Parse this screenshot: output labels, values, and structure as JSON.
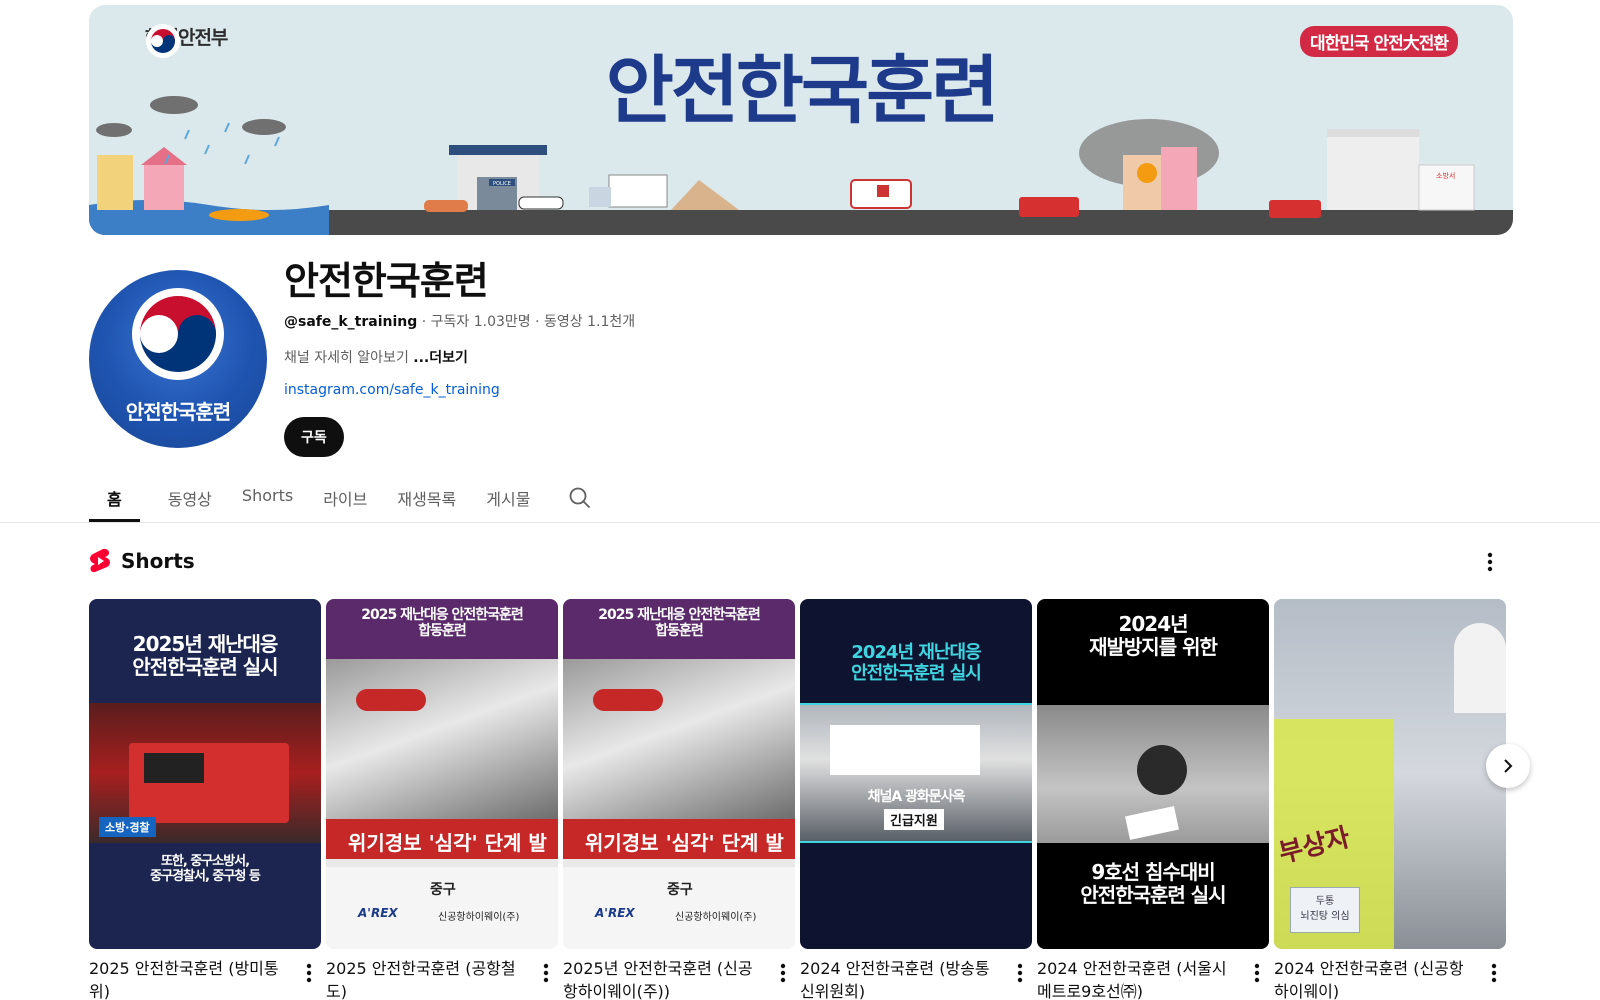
{
  "banner": {
    "ministry": "행정안전부",
    "title": "안전한국훈련",
    "badge": "대한민국 안전大전환",
    "police_sign": "POLICE",
    "fire_sign": "소방서"
  },
  "channel": {
    "avatar_label": "안전한국훈련",
    "name": "안전한국훈련",
    "handle": "@safe_k_training",
    "subscribers": "구독자 1.03만명",
    "videos": "동영상 1.1천개",
    "separator": " · ",
    "description": "채널 자세히 알아보기",
    "more": "...더보기",
    "link": "instagram.com/safe_k_training",
    "subscribe_label": "구독"
  },
  "tabs": [
    "홈",
    "동영상",
    "Shorts",
    "라이브",
    "재생목록",
    "게시물"
  ],
  "shelf": {
    "title": "Shorts"
  },
  "shorts": [
    {
      "title": "2025 안전한국훈련 (방미통위)",
      "thumb": {
        "top_text": "2025년 재난대응\n안전한국훈련 실시",
        "tag": "소방·경찰",
        "bottom_text": "또한, 중구소방서,\n중구경찰서, 중구청 등"
      }
    },
    {
      "title": "2025 안전한국훈련 (공항철도)",
      "thumb": {
        "top_text": "2025 재난대응 안전한국훈련\n합동훈련",
        "alert": "위기경보 '심각' 단계 발",
        "logo1": "중구",
        "logo2": "A'REX",
        "logo3": "신공항하이웨이(주)"
      }
    },
    {
      "title": "2025년 안전한국훈련 (신공항하이웨이(주))",
      "thumb": {
        "top_text": "2025 재난대응 안전한국훈련\n합동훈련",
        "alert": "위기경보 '심각' 단계 발",
        "logo1": "중구",
        "logo2": "A'REX",
        "logo3": "신공항하이웨이(주)"
      }
    },
    {
      "title": "2024 안전한국훈련 (방송통신위원회)",
      "thumb": {
        "top_text": "2024년 재난대응\n안전한국훈련 실시",
        "caption": "채널A 광화문사옥",
        "caption2": "긴급지원"
      }
    },
    {
      "title": "2024 안전한국훈련 (서울시메트로9호선㈜)",
      "thumb": {
        "top_text": "2024년\n재발방지를 위한",
        "bottom_text": "9호선 침수대비\n안전한국훈련 실시"
      }
    },
    {
      "title": "2024 안전한국훈련 (신공항하이웨이)",
      "thumb": {
        "vest_text": "부상자",
        "note_text": "두통\n뇌진탕 의심"
      }
    }
  ],
  "icons": {
    "search": "search-icon",
    "more": "more-vert-icon",
    "shorts": "shorts-logo-icon",
    "next": "chevron-right-icon"
  }
}
